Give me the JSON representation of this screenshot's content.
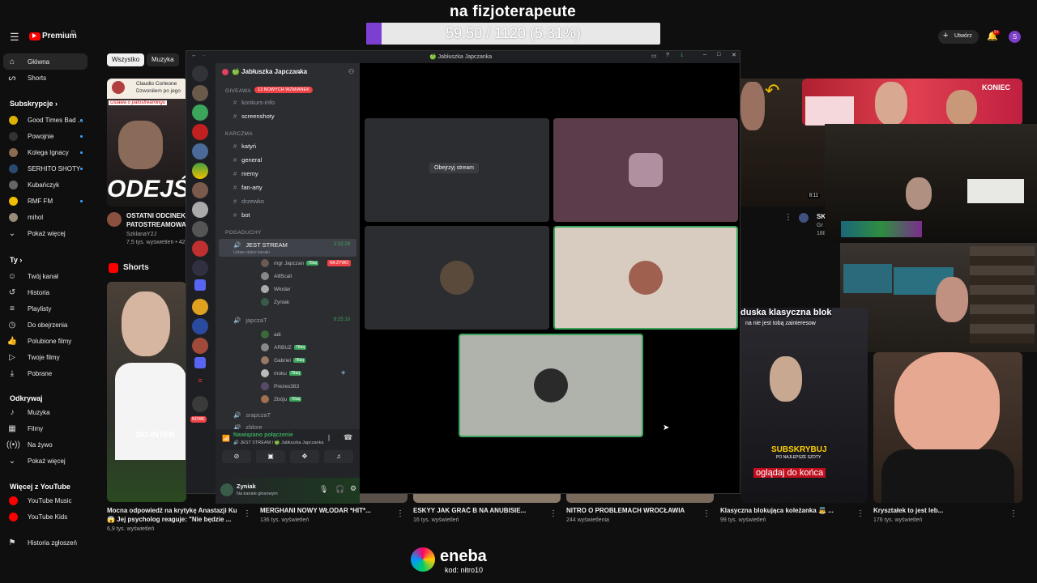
{
  "overlay": {
    "title": "na fizjoterapeute",
    "progress_text": "59.50 / 1120 (5.31%)",
    "progress_fraction": 0.0531,
    "progress_color": "#7b3fd1"
  },
  "youtube": {
    "logo": "Premium",
    "logo_sup": "PL",
    "create_label": "Utwórz",
    "notif_count": "9+",
    "avatar_letter": "S",
    "chips": [
      "Wszystko",
      "Muzyka"
    ],
    "nav_main": [
      "Główna",
      "Shorts"
    ],
    "subs_header": "Subskrypcje",
    "subs": [
      "Good Times Bad ...",
      "Powojnie",
      "Kolega Ignacy",
      "SERHITO SHOTY",
      "Kubańczyk",
      "RMF FM",
      "mihol"
    ],
    "show_more": "Pokaż więcej",
    "you_header": "Ty",
    "you_items": [
      "Twój kanał",
      "Historia",
      "Playlisty",
      "Do obejrzenia",
      "Polubione filmy",
      "Twoje filmy",
      "Pobrane"
    ],
    "explore_header": "Odkrywaj",
    "explore_items": [
      "Muzyka",
      "Filmy",
      "Na żywo",
      "Pokaż więcej"
    ],
    "more_header": "Więcej z YouTube",
    "more_items": [
      "YouTube Music",
      "YouTube Kids"
    ],
    "report_history": "Historia zgłoszeń",
    "shorts_label": "Shorts",
    "video1": {
      "title": "OSTATNI ODCINEK?",
      "title2": "PATOSTREAMOWA!",
      "channel": "SzklanaY2J",
      "meta": "7,5 tys. wyświetleń • 42",
      "thumb_text": "ODEJŚ",
      "notif_name": "Claudio Corleone",
      "notif_text": "Dzwoniłem po jego",
      "notif_sub": "Ustawa o patostreamingu"
    },
    "video_right": {
      "duration": "8:11",
      "badge": "KONIEC",
      "letters": "SK",
      "letters2": "Gr",
      "count": "188"
    },
    "shorts": [
      {
        "title": "Mocna odpowiedź na krytykę Anastazji Kuś!",
        "title2": "😱 Jej psycholog reaguje: \"Nie będzie ...",
        "meta": "6,9 tys. wyświetleń",
        "thumb_text": "DO INTER"
      },
      {
        "title": "MERGHANI NOWY WŁODAR *HIT*...",
        "meta": "136 tys. wyświetleń"
      },
      {
        "title": "ESKYY JAK GRAĆ B NA ANUBISIE...",
        "meta": "16 tys. wyświetleń"
      },
      {
        "title": "NITRO O PROBLEMACH WROCŁAWIA",
        "meta": "244 wyświetlenia"
      },
      {
        "title": "Klasyczna blokująca koleżanka 👼 ...",
        "meta": "99 tys. wyświetleń",
        "caption": "duska klasyczna blok",
        "caption2": "na nie jest tobą zainteresow",
        "sub_badge": "SUBSKRYBUJ",
        "sub_small": "PO NAJLEPSZE SZOTY",
        "bottom": "oglądaj do końca"
      },
      {
        "title": "Kryształek to jest leb...",
        "meta": "176 tys. wyświetleń"
      }
    ]
  },
  "discord": {
    "window_title": "🍏 Jabłuszka Japczanka",
    "server_name": "🍏 Jabłuszka Japczanka",
    "mentions_badge": "13 NOWYCH WZMIANEK",
    "new_badge": "NOWE",
    "categories": [
      "GIVEAWA",
      "KARCZMA",
      "POGADUCHY"
    ],
    "channels_top": [
      "konkurs-info",
      "screenshoty"
    ],
    "channels_karczma": [
      "katyń",
      "general",
      "memy",
      "fan-arty",
      "drzewko",
      "bot"
    ],
    "voice1": {
      "name": "JEST STREAM",
      "time": "2:32:29",
      "status": "Ustaw status kanału"
    },
    "voice1_users": [
      {
        "name": "mgr Japczan",
        "tag": "78aq",
        "live": "NA ŻYWO"
      },
      {
        "name": "Alll5call"
      },
      {
        "name": "Włodar"
      },
      {
        "name": "Zyniak"
      }
    ],
    "voice2": {
      "name": "japczaT",
      "time": "8:25:10"
    },
    "voice2_users": [
      {
        "name": "adi"
      },
      {
        "name": "ARBUZ",
        "tag": "78aq"
      },
      {
        "name": "Gabriel",
        "tag": "78aq"
      },
      {
        "name": "moku",
        "tag": "78aq"
      },
      {
        "name": "Prezes383"
      },
      {
        "name": "Zbóju",
        "tag": "78aq"
      }
    ],
    "voice3": {
      "name": "srapczaT"
    },
    "voice4": {
      "name": "zblore"
    },
    "connection": {
      "status": "Nawiązano połączenie",
      "channel": "🔊 JEST STREAM / 🍏 Jabłuszka Japczanka"
    },
    "user": {
      "name": "Zyniak",
      "status": "Na kanale głosowym"
    },
    "watch_stream": "Obejrzyj stream"
  },
  "sponsor": {
    "name": "eneba",
    "code": "kod: nitro10"
  }
}
